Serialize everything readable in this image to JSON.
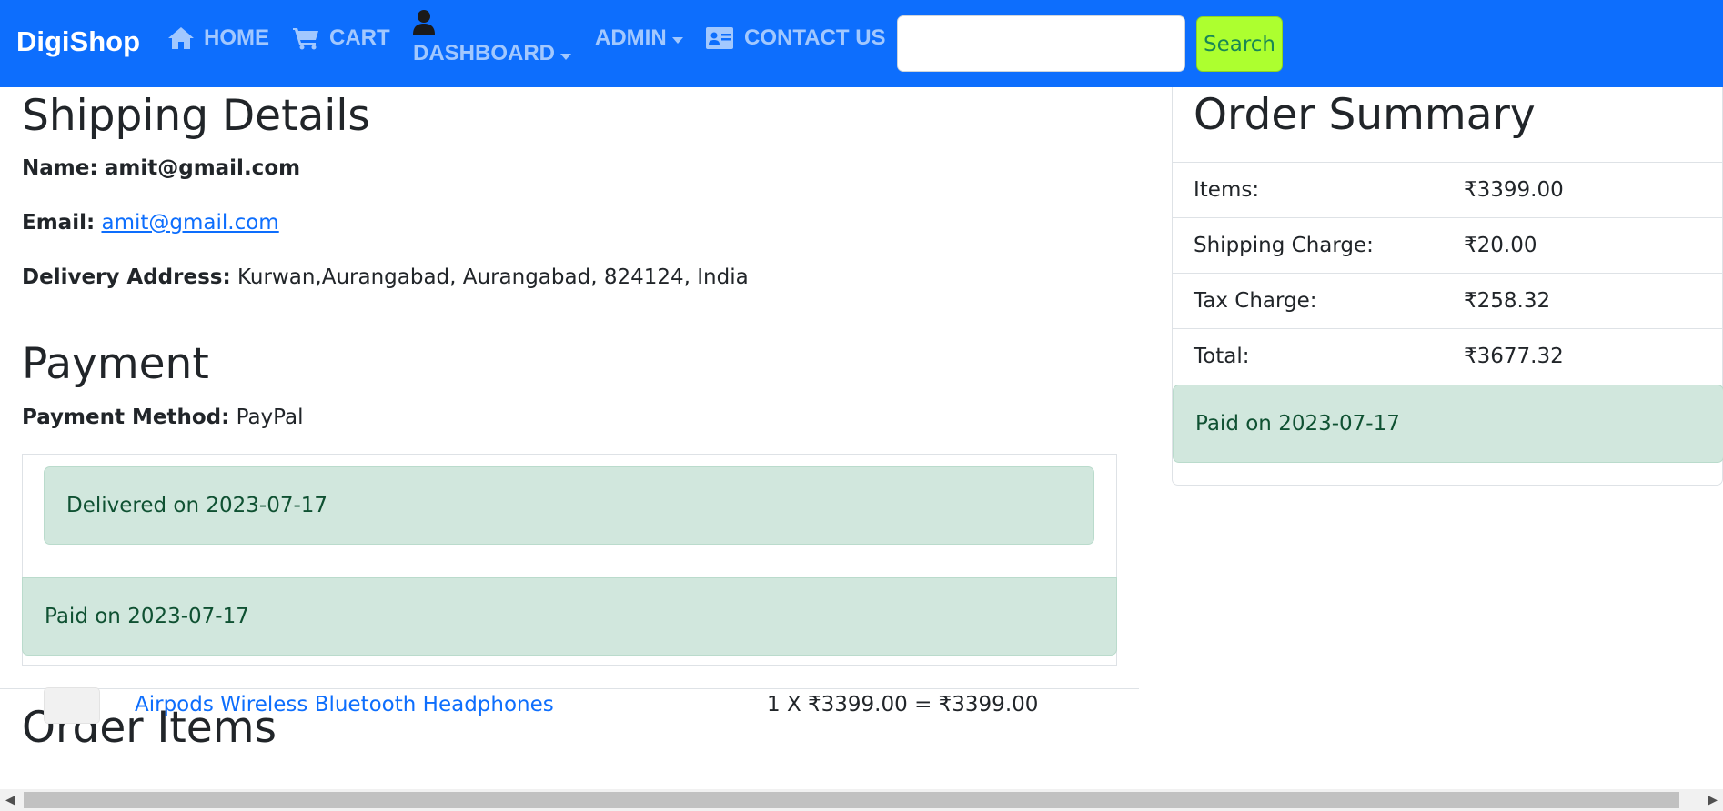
{
  "navbar": {
    "brand": "DigiShop",
    "home_label": "HOME",
    "cart_label": "CART",
    "dashboard_label": "DASHBOARD",
    "admin_label": "ADMIN",
    "contact_label": "CONTACT US",
    "search_placeholder": "",
    "search_button": "Search"
  },
  "shipping": {
    "title": "Shipping Details",
    "name_label": "Name:",
    "name_value": "amit@gmail.com",
    "email_label": "Email:",
    "email_value": "amit@gmail.com",
    "address_label": "Delivery Address:",
    "address_value": "Kurwan,Aurangabad, Aurangabad, 824124, India",
    "delivered_status": "Delivered on 2023-07-17"
  },
  "payment": {
    "title": "Payment",
    "method_label": "Payment Method:",
    "method_value": "PayPal",
    "paid_status": "Paid on 2023-07-17"
  },
  "order_items": {
    "title": "Order Items",
    "items": [
      {
        "name": "Airpods Wireless Bluetooth Headphones",
        "calc": "1 X ₹3399.00 = ₹3399.00"
      }
    ]
  },
  "summary": {
    "title": "Order Summary",
    "rows": [
      {
        "label": "Items:",
        "value": "₹3399.00"
      },
      {
        "label": "Shipping Charge:",
        "value": "₹20.00"
      },
      {
        "label": "Tax Charge:",
        "value": "₹258.32"
      },
      {
        "label": "Total:",
        "value": "₹3677.32"
      }
    ],
    "paid_status": "Paid on 2023-07-17"
  },
  "colors": {
    "navbar_bg": "#0d6efd",
    "search_btn_bg": "#adff2f",
    "success_alert_bg": "#d1e7dd",
    "link": "#0d6efd"
  }
}
